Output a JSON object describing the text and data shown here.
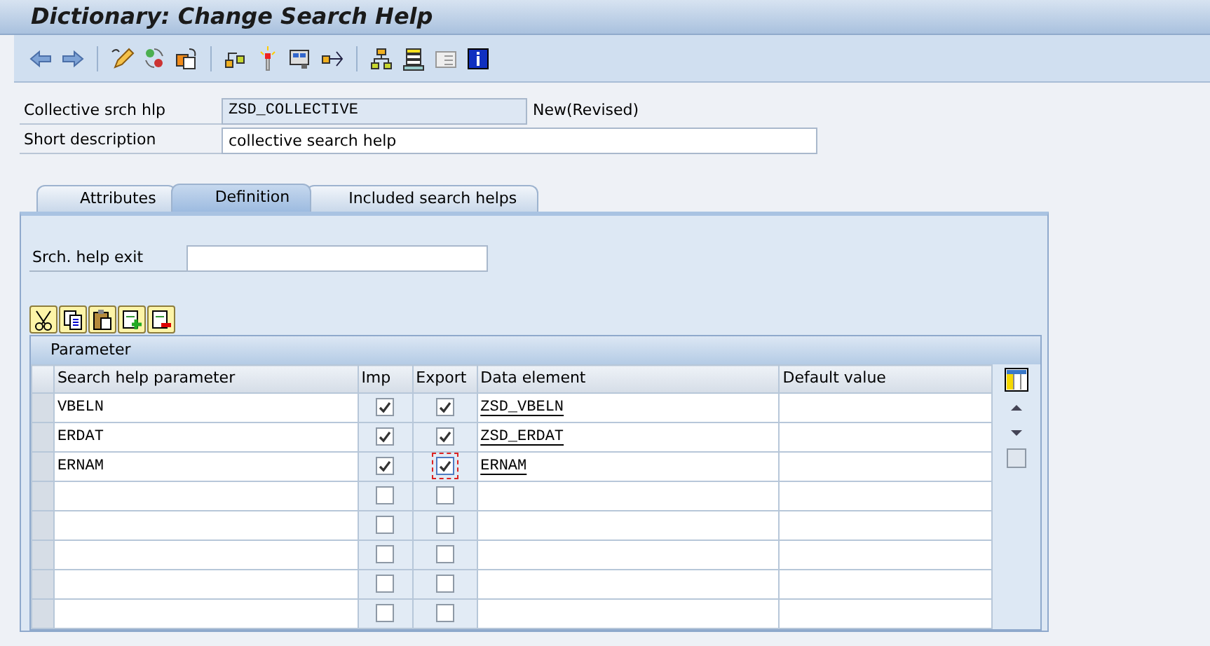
{
  "window": {
    "title": "Dictionary: Change Search Help"
  },
  "header_fields": [
    {
      "label": "Collective srch hlp",
      "value": "ZSD_COLLECTIVE",
      "readonly": true,
      "status": "New(Revised)"
    },
    {
      "label": "Short description",
      "value": "collective search help",
      "readonly": false
    }
  ],
  "tabs": [
    {
      "label": "Attributes",
      "selected": false
    },
    {
      "label": "Definition",
      "selected": true
    },
    {
      "label": "Included search helps",
      "selected": false
    }
  ],
  "exit_field": {
    "label": "Srch. help exit"
  },
  "table": {
    "title": "Parameter",
    "columns": [
      "Search help parameter",
      "Imp",
      "Export",
      "Data element",
      "Default value"
    ],
    "rows": [
      {
        "parameter": "VBELN",
        "imp": true,
        "export": true,
        "data_element": "ZSD_VBELN",
        "focused": false
      },
      {
        "parameter": "ERDAT",
        "imp": true,
        "export": true,
        "data_element": "ZSD_ERDAT",
        "focused": false
      },
      {
        "parameter": "ERNAM",
        "imp": true,
        "export": true,
        "data_element": "ERNAM",
        "focused": true
      },
      {
        "imp": false,
        "export": false,
        "focused": false
      },
      {
        "imp": false,
        "export": false,
        "focused": false
      },
      {
        "imp": false,
        "export": false,
        "focused": false
      },
      {
        "imp": false,
        "export": false,
        "focused": false
      },
      {
        "imp": false,
        "export": false,
        "focused": false
      }
    ]
  }
}
